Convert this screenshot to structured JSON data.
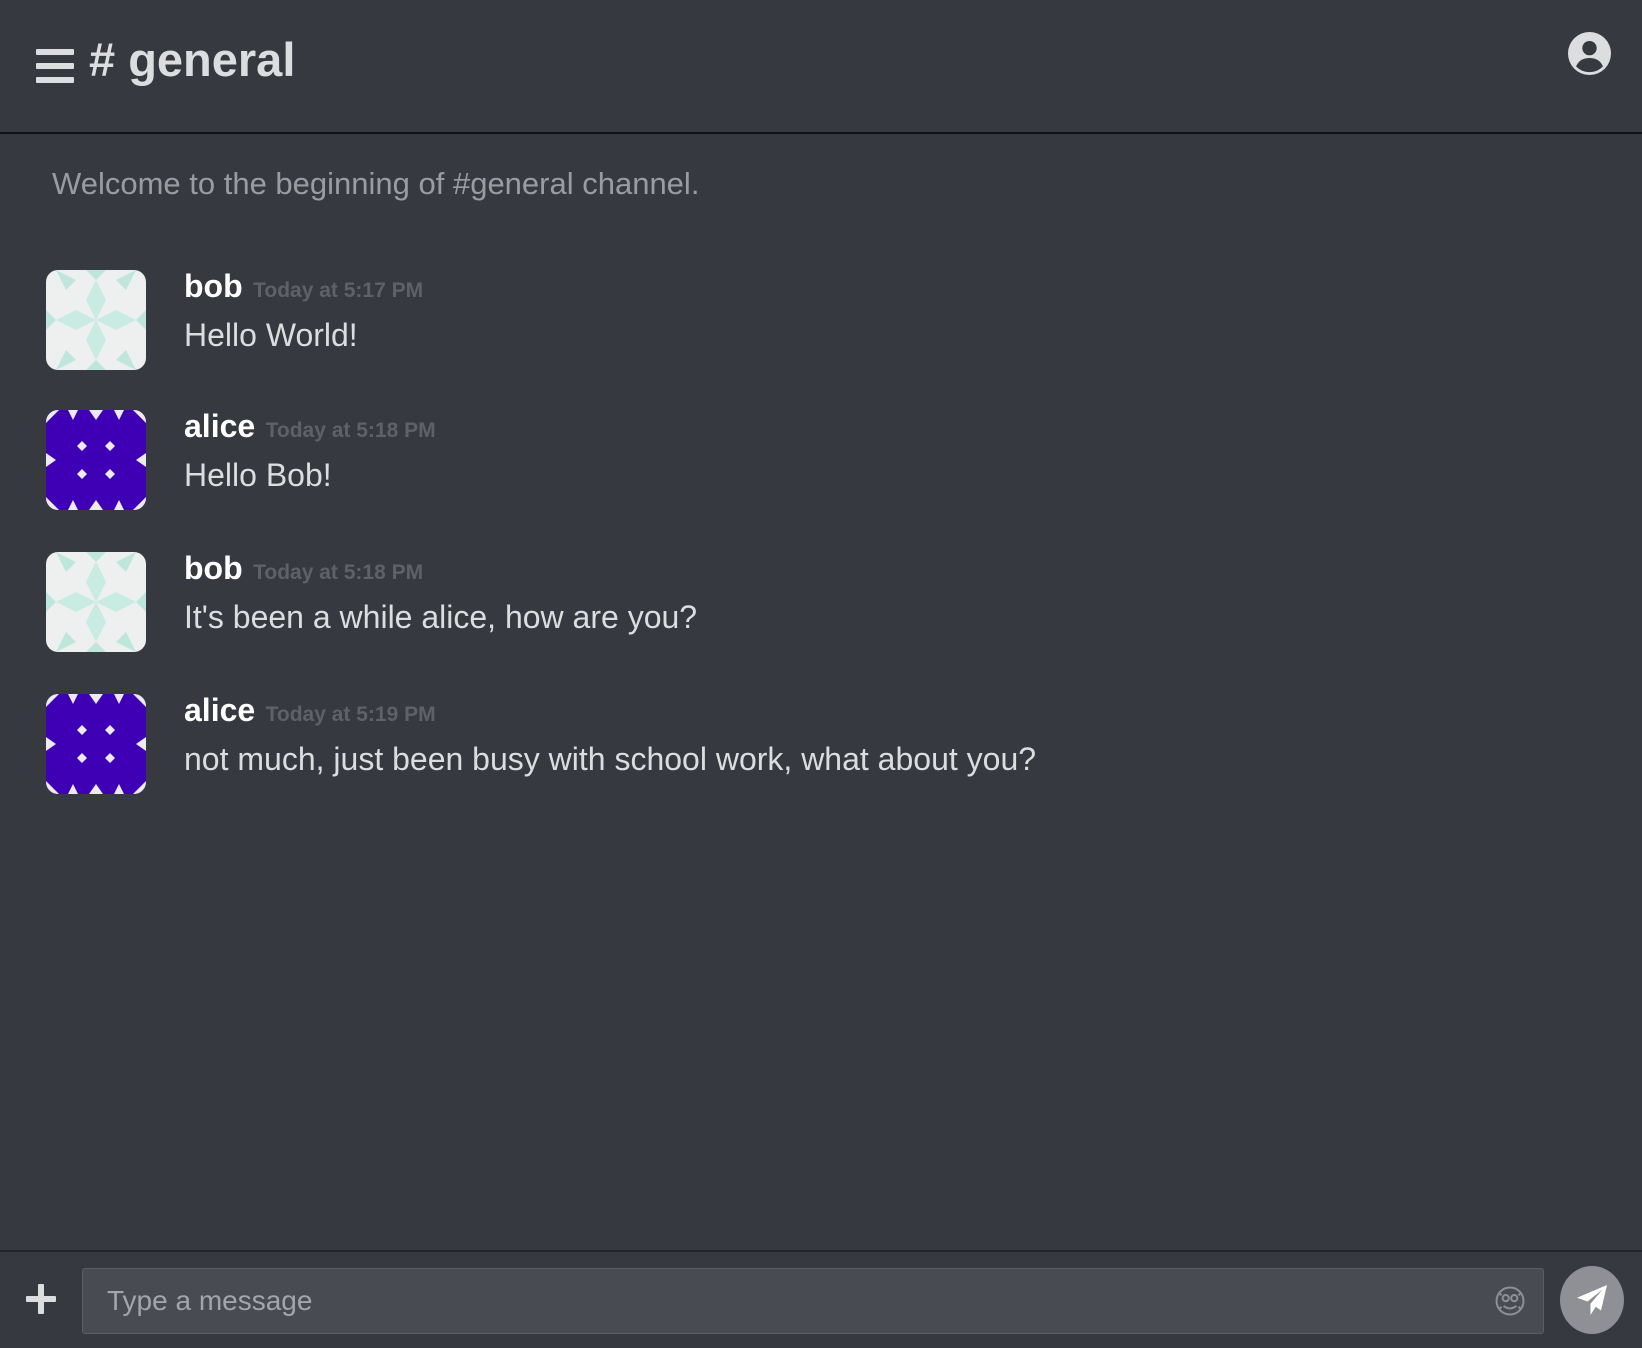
{
  "header": {
    "channel_title": "# general",
    "menu_icon": "hamburger-menu-icon",
    "account_icon": "account-circle-icon"
  },
  "welcome_text": "Welcome to the beginning of #general channel.",
  "messages": [
    {
      "author": "bob",
      "timestamp": "Today at 5:17 PM",
      "text": "Hello World!",
      "avatar": "bob-identicon"
    },
    {
      "author": "alice",
      "timestamp": "Today at 5:18 PM",
      "text": "Hello Bob!",
      "avatar": "alice-identicon"
    },
    {
      "author": "bob",
      "timestamp": "Today at 5:18 PM",
      "text": "It's been a while alice, how are you?",
      "avatar": "bob-identicon"
    },
    {
      "author": "alice",
      "timestamp": "Today at 5:19 PM",
      "text": "not much, just been busy with school work, what about you?",
      "avatar": "alice-identicon"
    }
  ],
  "composer": {
    "placeholder": "Type a message",
    "attach_icon": "plus-icon",
    "emoji_icon": "emoji-icon",
    "send_icon": "send-icon"
  },
  "colors": {
    "background": "#36393f",
    "bob_avatar_fg": "#b9e6dc",
    "alice_avatar_fg": "#3f00b5",
    "avatar_bg": "#f0f0f0",
    "send_button": "#8e9095"
  }
}
